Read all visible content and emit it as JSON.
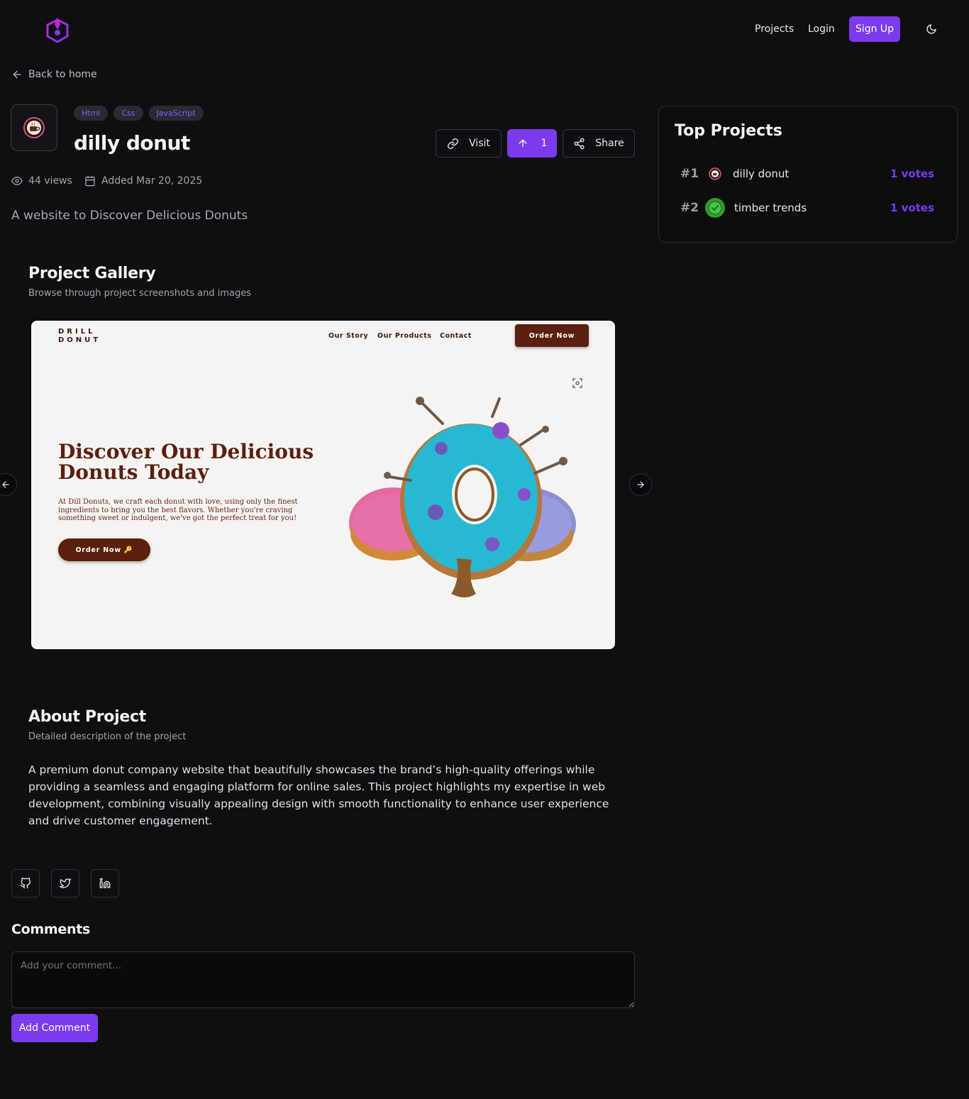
{
  "nav": {
    "projects": "Projects",
    "login": "Login",
    "signup": "Sign Up"
  },
  "back_label": "Back to home",
  "project": {
    "tags": [
      "Html",
      "Css",
      "JavaScript"
    ],
    "title": "dilly donut",
    "visit_label": "Visit",
    "vote_count": "1",
    "share_label": "Share",
    "views": "44 views",
    "added": "Added Mar 20, 2025",
    "description": "A website to Discover Delicious Donuts"
  },
  "top_projects": {
    "title": "Top Projects",
    "items": [
      {
        "rank": "#1",
        "name": "dilly donut",
        "votes": "1 votes"
      },
      {
        "rank": "#2",
        "name": "timber trends",
        "votes": "1 votes"
      }
    ]
  },
  "gallery": {
    "title": "Project Gallery",
    "subtitle": "Browse through project screenshots and images",
    "screenshot": {
      "brand_line1": "DRILL",
      "brand_line2": "DONUT",
      "nav": [
        "Our Story",
        "Our Products",
        "Contact"
      ],
      "order_now": "Order Now",
      "heading": "Discover Our Delicious Donuts Today",
      "text": "At Dill Donuts, we craft each donut with love, using only the finest ingredients to bring you the best flavors. Whether you're craving something sweet or indulgent, we've got the perfect treat for you!",
      "cta": "Order Now"
    }
  },
  "about": {
    "title": "About Project",
    "subtitle": "Detailed description of the project",
    "text": "A premium donut company website that beautifully showcases the brand’s high-quality offerings while providing a seamless and engaging platform for online sales. This project highlights my expertise in web development, combining visually appealing design with smooth functionality to enhance user experience and drive customer engagement."
  },
  "comments": {
    "title": "Comments",
    "placeholder": "Add your comment...",
    "submit": "Add Comment"
  },
  "colors": {
    "accent": "#7c3aed",
    "background": "#0f0f12",
    "brand_brown": "#5b1f0e"
  }
}
